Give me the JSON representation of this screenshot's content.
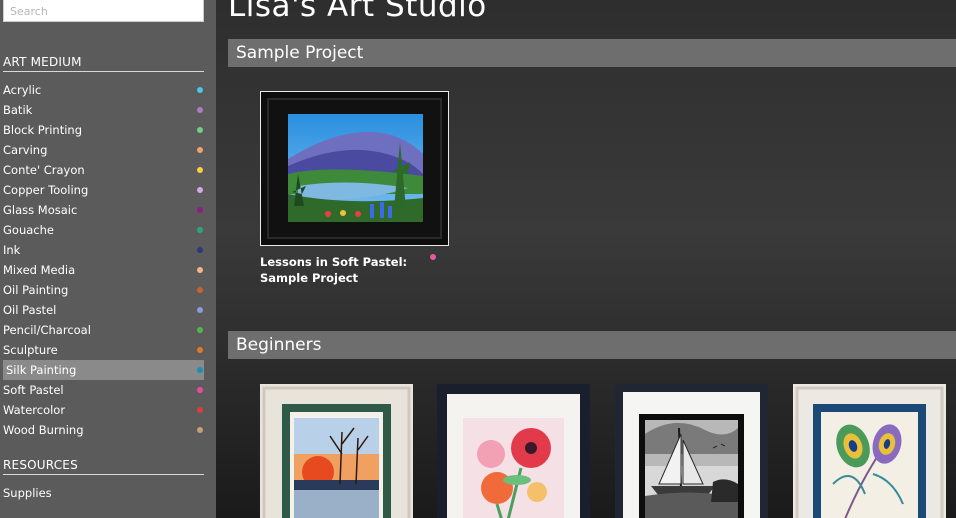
{
  "search": {
    "placeholder": "Search"
  },
  "sidebar": {
    "art_medium_title": "ART MEDIUM",
    "items": [
      {
        "label": "Acrylic",
        "color": "#4ec3e8"
      },
      {
        "label": "Batik",
        "color": "#b07ac2"
      },
      {
        "label": "Block Printing",
        "color": "#6fd18a"
      },
      {
        "label": "Carving",
        "color": "#f0a36c"
      },
      {
        "label": "Conte' Crayon",
        "color": "#f5d23a"
      },
      {
        "label": "Copper Tooling",
        "color": "#d6a8e8"
      },
      {
        "label": "Glass Mosaic",
        "color": "#8a1f7f"
      },
      {
        "label": "Gouache",
        "color": "#2aa87a"
      },
      {
        "label": "Ink",
        "color": "#2a3a7a"
      },
      {
        "label": "Mixed Media",
        "color": "#f2b48c"
      },
      {
        "label": "Oil Painting",
        "color": "#c8632a"
      },
      {
        "label": "Oil Pastel",
        "color": "#8a9ae0"
      },
      {
        "label": "Pencil/Charcoal",
        "color": "#4fb84f"
      },
      {
        "label": "Sculpture",
        "color": "#e07a2a"
      },
      {
        "label": "Silk Painting",
        "color": "#1c8fb0"
      },
      {
        "label": "Soft Pastel",
        "color": "#e64aa0"
      },
      {
        "label": "Watercolor",
        "color": "#e23a3a"
      },
      {
        "label": "Wood Burning",
        "color": "#c8a07a"
      }
    ],
    "active_item": "Silk Painting",
    "resources_title": "RESOURCES",
    "resources_items": [
      "Supplies"
    ]
  },
  "main": {
    "site_title": "Lisa's Art Studio",
    "sections": [
      {
        "title": "Sample Project",
        "projects": [
          {
            "caption": "Lessons in Soft Pastel: Sample Project",
            "dot_color": "#e85aa0"
          }
        ]
      },
      {
        "title": "Beginners",
        "thumbnails": [
          "sunset-watercolor",
          "poppy-flowers",
          "sailboat-charcoal",
          "peacock-feather"
        ]
      }
    ]
  }
}
